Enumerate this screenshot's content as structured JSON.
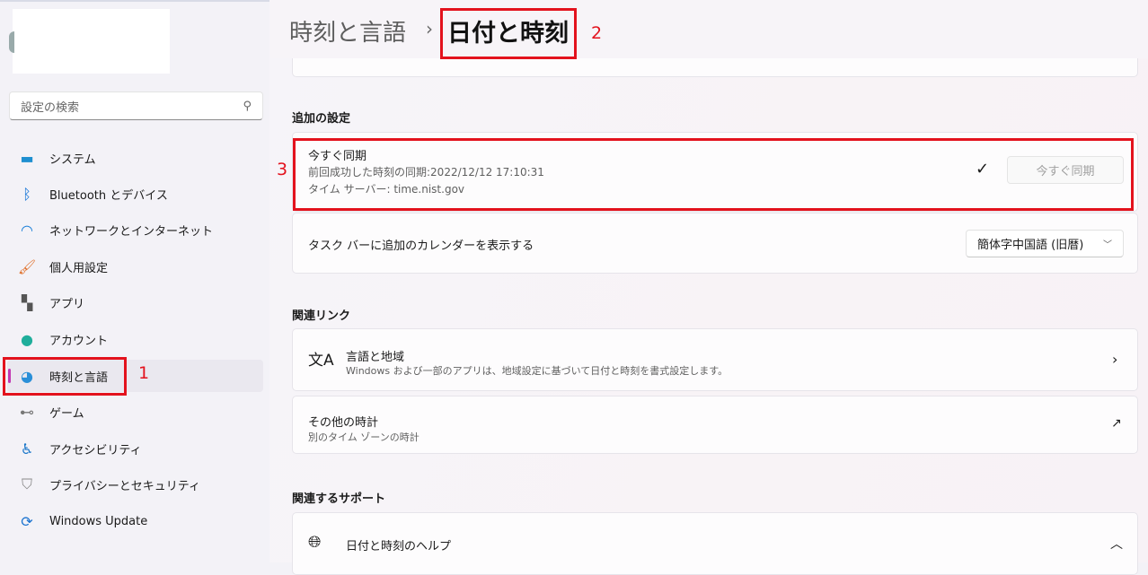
{
  "sidebar": {
    "search_placeholder": "設定の検索",
    "items": [
      {
        "label": "システム",
        "icon": "system-icon"
      },
      {
        "label": "Bluetooth とデバイス",
        "icon": "bluetooth-icon"
      },
      {
        "label": "ネットワークとインターネット",
        "icon": "wifi-icon"
      },
      {
        "label": "個人用設定",
        "icon": "brush-icon"
      },
      {
        "label": "アプリ",
        "icon": "apps-icon"
      },
      {
        "label": "アカウント",
        "icon": "account-icon"
      },
      {
        "label": "時刻と言語",
        "icon": "time-language-icon",
        "selected": true
      },
      {
        "label": "ゲーム",
        "icon": "gamepad-icon"
      },
      {
        "label": "アクセシビリティ",
        "icon": "accessibility-icon"
      },
      {
        "label": "プライバシーとセキュリティ",
        "icon": "shield-icon"
      },
      {
        "label": "Windows Update",
        "icon": "update-icon"
      }
    ]
  },
  "header": {
    "parent": "時刻と言語",
    "separator": "›",
    "title": "日付と時刻"
  },
  "annotations": [
    "1",
    "2",
    "3"
  ],
  "accent": "#c239b3",
  "annotation_color": "#e3121d",
  "additional": {
    "heading": "追加の設定",
    "sync": {
      "title": "今すぐ同期",
      "last": "前回成功した時刻の同期:2022/12/12 17:10:31",
      "server": "タイム サーバー: time.nist.gov",
      "button": "今すぐ同期",
      "status": "✓"
    },
    "calendar": {
      "label": "タスク バーに追加のカレンダーを表示する",
      "value": "簡体字中国語 (旧暦)"
    }
  },
  "related_links": {
    "heading": "関連リンク",
    "items": [
      {
        "title": "言語と地域",
        "sub": "Windows および一部のアプリは、地域設定に基づいて日付と時刻を書式設定します。"
      },
      {
        "title": "その他の時計",
        "sub": "別のタイム ゾーンの時計"
      }
    ]
  },
  "support": {
    "heading": "関連するサポート",
    "item": "日付と時刻のヘルプ"
  }
}
